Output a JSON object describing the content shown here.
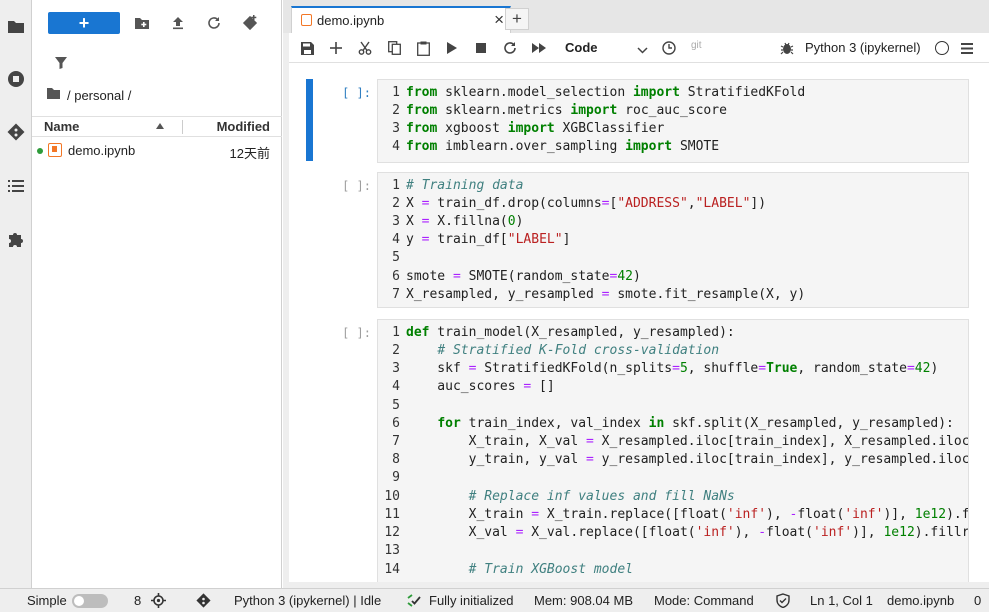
{
  "filebrowser": {
    "breadcrumb": "/ personal /",
    "columns": {
      "name": "Name",
      "modified": "Modified"
    },
    "files": [
      {
        "name": "demo.ipynb",
        "modified": "12天前"
      }
    ]
  },
  "tabs": [
    {
      "label": "demo.ipynb"
    }
  ],
  "notebook_toolbar": {
    "cell_type": "Code",
    "git_label": "git",
    "kernel": "Python 3 (ipykernel)"
  },
  "cells": [
    {
      "prompt": "[ ]:",
      "line_numbers": [
        "1",
        "2",
        "3",
        "4"
      ],
      "lines": [
        "from sklearn.model_selection import StratifiedKFold",
        "from sklearn.metrics import roc_auc_score",
        "from xgboost import XGBClassifier",
        "from imblearn.over_sampling import SMOTE"
      ]
    },
    {
      "prompt": "[ ]:",
      "line_numbers": [
        "1",
        "2",
        "3",
        "4",
        "5",
        "6",
        "7"
      ],
      "lines": [
        "# Training data",
        "X = train_df.drop(columns=[\"ADDRESS\",\"LABEL\"])",
        "X = X.fillna(0)",
        "y = train_df[\"LABEL\"]",
        "",
        "smote = SMOTE(random_state=42)",
        "X_resampled, y_resampled = smote.fit_resample(X, y)"
      ]
    },
    {
      "prompt": "[ ]:",
      "line_numbers": [
        "1",
        "2",
        "3",
        "4",
        "5",
        "6",
        "7",
        "8",
        "9",
        "10",
        "11",
        "12",
        "13",
        "14"
      ],
      "lines": [
        "def train_model(X_resampled, y_resampled):",
        "    # Stratified K-Fold cross-validation",
        "    skf = StratifiedKFold(n_splits=5, shuffle=True, random_state=42)",
        "    auc_scores = []",
        "",
        "    for train_index, val_index in skf.split(X_resampled, y_resampled):",
        "        X_train, X_val = X_resampled.iloc[train_index], X_resampled.iloc",
        "        y_train, y_val = y_resampled.iloc[train_index], y_resampled.iloc",
        "",
        "        # Replace inf values and fill NaNs",
        "        X_train = X_train.replace([float('inf'), -float('inf')], 1e12).f",
        "        X_val = X_val.replace([float('inf'), -float('inf')], 1e12).fillr",
        "",
        "        # Train XGBoost model"
      ]
    }
  ],
  "statusbar": {
    "mode_label": "Simple",
    "terminal_count": "8",
    "kernel_status": "Python 3 (ipykernel) | Idle",
    "lsp": "Fully initialized",
    "memory": "Mem: 908.04 MB",
    "mode": "Mode: Command",
    "cursor": "Ln 1, Col 1",
    "file": "demo.ipynb",
    "trailing": "0"
  },
  "colors": {
    "accent": "#1976d2",
    "notebook_orange": "#f37726",
    "running_green": "#2e9b3a"
  },
  "icons": [
    "folder-icon",
    "running-icon",
    "git-icon",
    "toc-icon",
    "extension-icon",
    "plus-icon",
    "new-folder-icon",
    "upload-icon",
    "refresh-icon",
    "git-clone-icon",
    "filter-icon",
    "save-icon",
    "cut-icon",
    "copy-icon",
    "paste-icon",
    "run-icon",
    "stop-icon",
    "restart-icon",
    "fast-forward-icon",
    "clock-icon",
    "bug-icon",
    "menu-icon"
  ]
}
